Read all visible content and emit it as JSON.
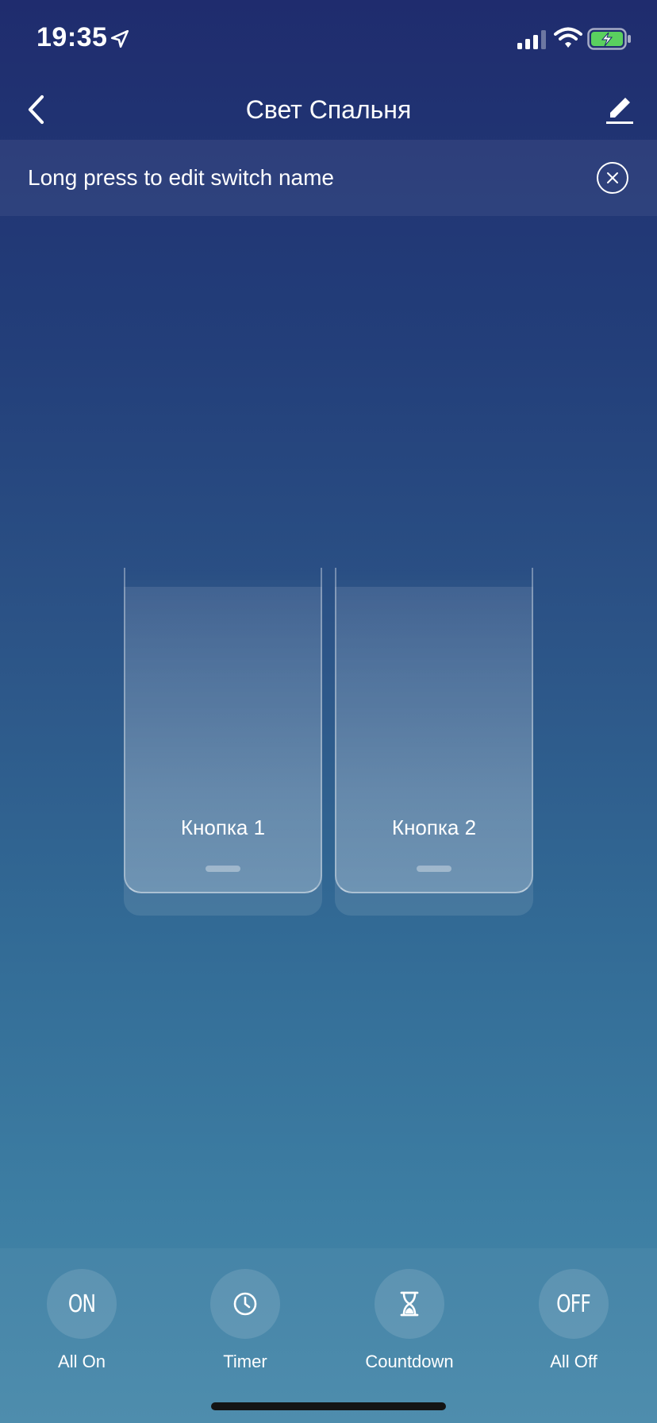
{
  "status_bar": {
    "time": "19:35",
    "icons": [
      "location-arrow-icon",
      "signal-icon",
      "wifi-icon",
      "battery-charging-icon"
    ]
  },
  "nav": {
    "title": "Свет Спальня",
    "back_icon": "chevron-left-icon",
    "edit_icon": "pencil-icon"
  },
  "banner": {
    "text": "Long press to edit switch name",
    "close_icon": "close-circle-icon"
  },
  "switches": [
    {
      "label": "Кнопка 1"
    },
    {
      "label": "Кнопка 2"
    }
  ],
  "actions": [
    {
      "glyph": "ON",
      "label": "All On",
      "icon": "on-icon"
    },
    {
      "glyph": "",
      "label": "Timer",
      "icon": "clock-icon"
    },
    {
      "glyph": "",
      "label": "Countdown",
      "icon": "hourglass-icon"
    },
    {
      "glyph": "OFF",
      "label": "All Off",
      "icon": "off-icon"
    }
  ],
  "colors": {
    "gradient_top": "#1f2c6e",
    "gradient_bottom": "#4789aa",
    "text": "#ffffff",
    "battery_fill": "#5ad05f"
  }
}
